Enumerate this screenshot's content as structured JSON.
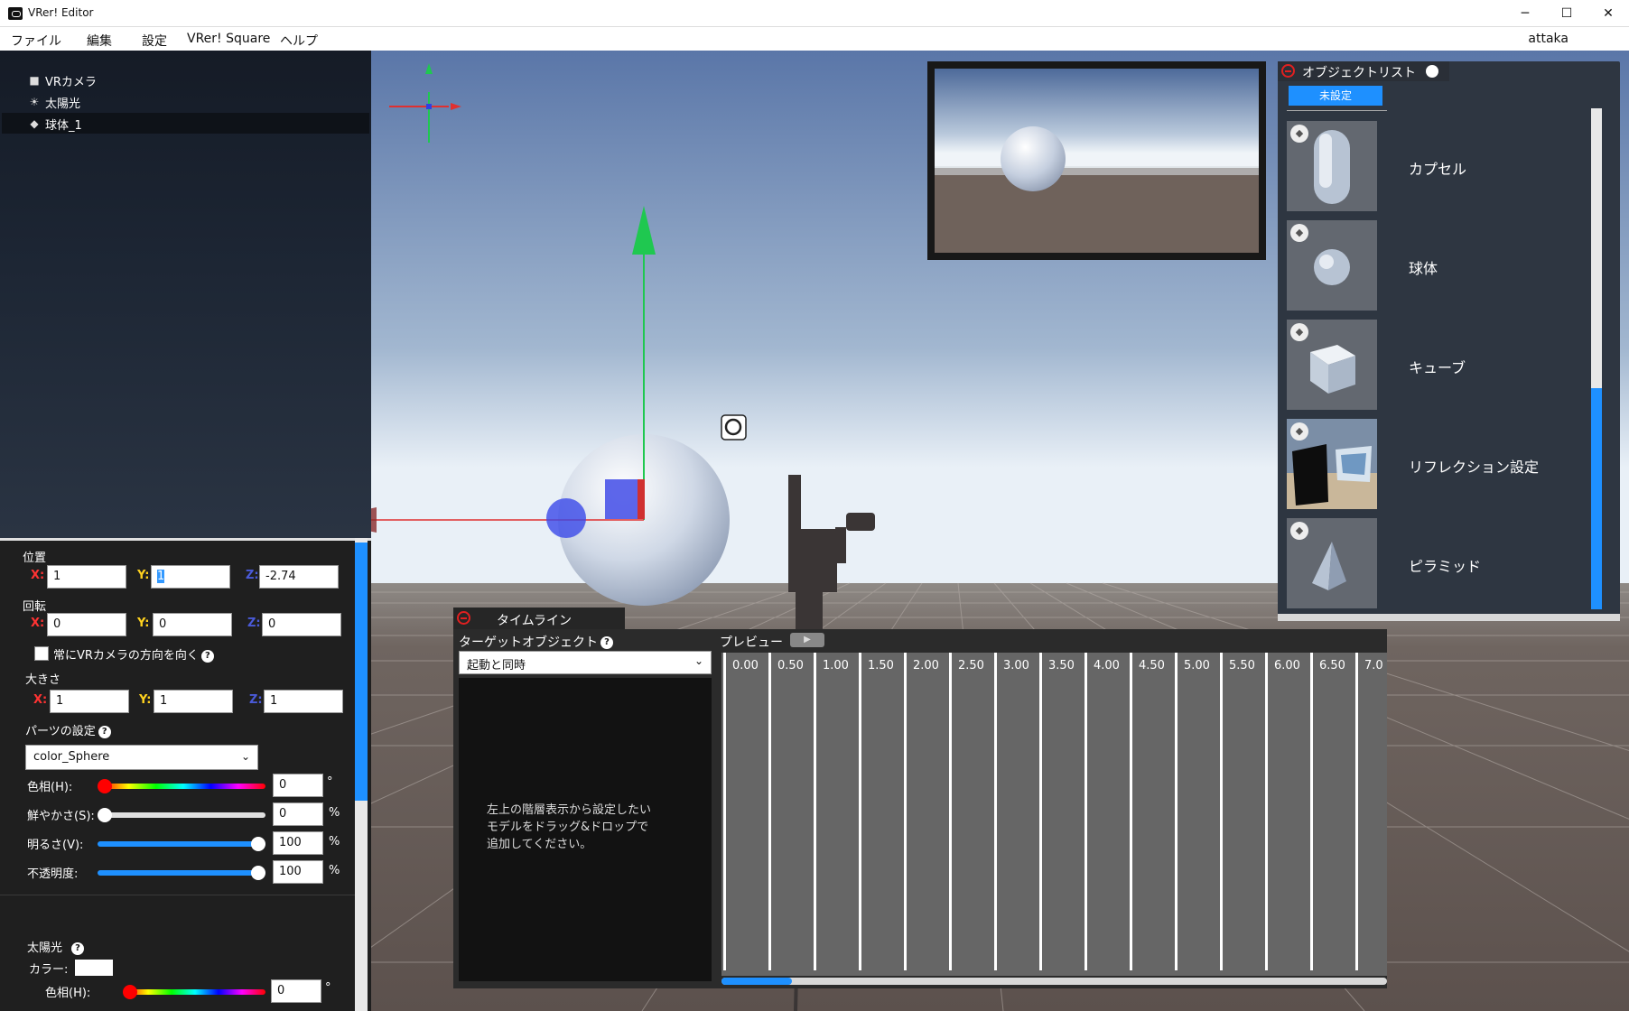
{
  "window": {
    "title": "VRer! Editor",
    "controls": [
      "─",
      "☐",
      "✕"
    ]
  },
  "menubar": {
    "items": [
      "ファイル",
      "編集",
      "設定",
      "VRer! Square",
      "ヘルプ"
    ],
    "user": "attaka"
  },
  "hierarchy": {
    "items": [
      {
        "label": "VRカメラ",
        "icon": "video-camera-icon"
      },
      {
        "label": "太陽光",
        "icon": "sun-icon"
      },
      {
        "label": "球体_1",
        "icon": "cube-icon",
        "selected": true
      }
    ]
  },
  "inspector": {
    "position": {
      "label": "位置",
      "x": "1",
      "y": "1",
      "z": "-2.74"
    },
    "rotation": {
      "label": "回転",
      "x": "0",
      "y": "0",
      "z": "0"
    },
    "face_camera_label": "常にVRカメラの方向を向く",
    "scale": {
      "label": "大きさ",
      "x": "1",
      "y": "1",
      "z": "1"
    },
    "axis_labels": {
      "x": "X:",
      "y": "Y:",
      "z": "Z:"
    },
    "parts": {
      "label": "パーツの設定",
      "selected": "color_Sphere"
    },
    "hue": {
      "label": "色相(H):",
      "value": "0",
      "unit": "°"
    },
    "saturation": {
      "label": "鮮やかさ(S):",
      "value": "0",
      "unit": "%"
    },
    "brightness": {
      "label": "明るさ(V):",
      "value": "100",
      "unit": "%"
    },
    "opacity": {
      "label": "不透明度:",
      "value": "100",
      "unit": "%"
    },
    "sunlight": {
      "label": "太陽光",
      "color_label": "カラー:",
      "hue_label": "色相(H):",
      "hue_value": "0",
      "hue_unit": "°"
    },
    "help_glyph": "?"
  },
  "object_list": {
    "title": "オブジェクトリスト",
    "filter": "未設定",
    "items": [
      {
        "label": "カプセル",
        "shape": "capsule"
      },
      {
        "label": "球体",
        "shape": "sphere"
      },
      {
        "label": "キューブ",
        "shape": "cube"
      },
      {
        "label": "リフレクション設定",
        "shape": "reflection"
      },
      {
        "label": "ピラミッド",
        "shape": "pyramid"
      }
    ],
    "scroll_fraction": 0.55
  },
  "timeline": {
    "title": "タイムライン",
    "target_label": "ターゲットオブジェクト",
    "target_select": "起動と同時",
    "drop_hint": "左上の階層表示から設定したい\nモデルをドラッグ&ドロップで\n追加してください。",
    "preview_label": "プレビュー",
    "play_glyph": "▶",
    "ticks": [
      "0.00",
      "0.50",
      "1.00",
      "1.50",
      "2.00",
      "2.50",
      "3.00",
      "3.50",
      "4.00",
      "4.50",
      "5.00",
      "5.50",
      "6.00",
      "6.50",
      "7.0"
    ],
    "scroll_fraction": 0.1
  },
  "colors": {
    "accent": "#1e90ff",
    "close_red": "#e02020",
    "axis_x": "#ff3333",
    "axis_y": "#ffd21e",
    "axis_z": "#4a5ad8",
    "gizmo_green": "#1fc850"
  }
}
